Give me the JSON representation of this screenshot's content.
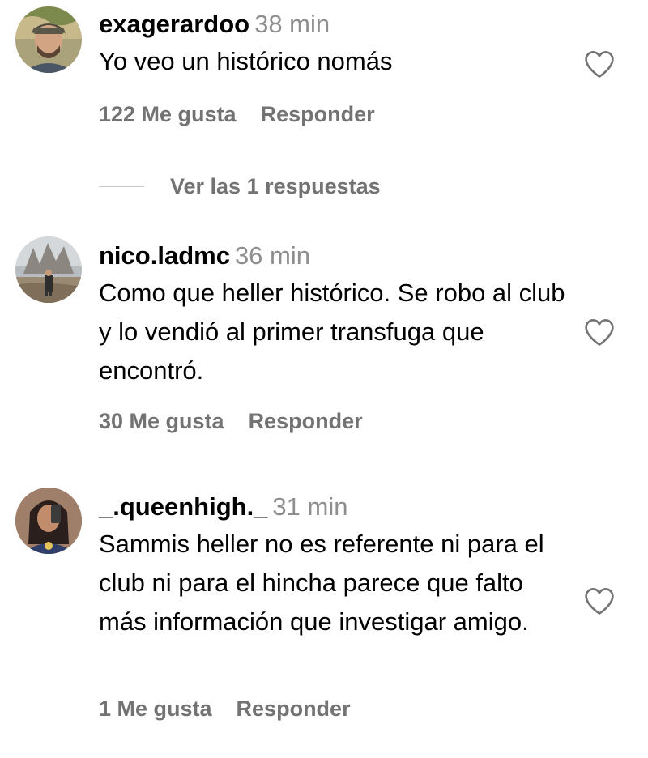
{
  "comments": [
    {
      "username": "exagerardoo",
      "time": "38 min",
      "text": "Yo veo un histórico nomás",
      "likes": "122 Me gusta",
      "reply": "Responder"
    },
    {
      "username": "nico.ladmc",
      "time": "36 min",
      "text": "Como que heller histórico. Se robo al club y lo vendió al primer transfuga que encontró.",
      "likes": "30 Me gusta",
      "reply": "Responder"
    },
    {
      "username": "_.queenhigh._",
      "time": "31 min",
      "text": "Sammis heller no es referente ni para el club ni para el hincha parece que falto más información que investigar amigo.",
      "likes": "1 Me gusta",
      "reply": "Responder"
    }
  ],
  "view_replies": {
    "label": "Ver las 1 respuestas"
  },
  "icons": {
    "like": "heart-outline-icon"
  },
  "colors": {
    "username": "#000000",
    "secondary": "#737373",
    "time": "#8e8e8e"
  }
}
